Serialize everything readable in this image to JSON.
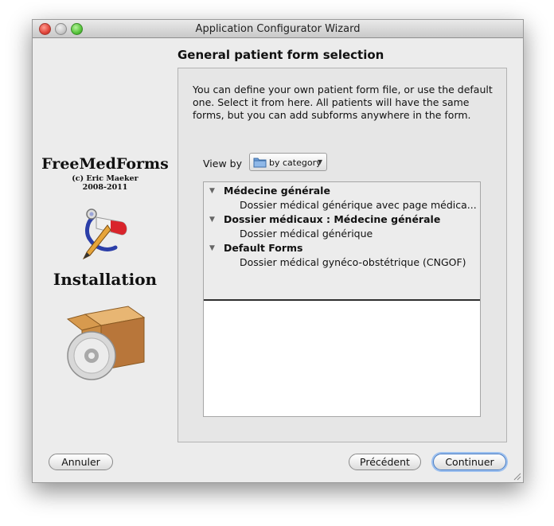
{
  "window": {
    "title": "Application Configurator Wizard"
  },
  "page": {
    "title": "General patient form selection"
  },
  "left_panel": {
    "brand": "FreeMedForms",
    "copyright_line1": "(c) Eric Maeker",
    "copyright_line2": "2008-2011",
    "section_label": "Installation"
  },
  "content": {
    "description": "You can define your own patient form file, or use the default one. Select it from here. All patients will have the same forms, but you can add subforms anywhere in the form.",
    "view_by_label": "View by",
    "view_by_value": "by category",
    "tree": [
      {
        "kind": "category",
        "label": "Médecine générale"
      },
      {
        "kind": "form",
        "label": "Dossier médical générique avec page médica..."
      },
      {
        "kind": "category",
        "label": "Dossier médicaux : Médecine générale"
      },
      {
        "kind": "form",
        "label": "Dossier médical générique"
      },
      {
        "kind": "category",
        "label": "Default Forms"
      },
      {
        "kind": "form",
        "label": "Dossier médical gynéco-obstétrique (CNGOF)"
      }
    ]
  },
  "buttons": {
    "cancel": "Annuler",
    "previous": "Précédent",
    "next": "Continuer"
  },
  "colors": {
    "default_button_focus": "#9cc0ef",
    "window_background": "#ececec"
  }
}
